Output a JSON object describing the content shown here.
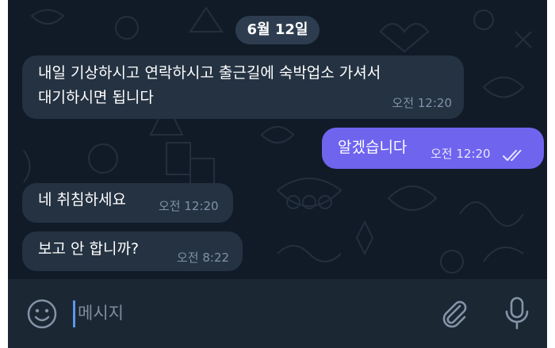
{
  "colors": {
    "background": "#111b28",
    "incoming_bubble": "#243242",
    "outgoing_bubble": "#6e64ee",
    "date_badge": "#2d3d4f",
    "input_bar": "#1c2734",
    "caret": "#5a98ea"
  },
  "chat": {
    "date_label": "6월 12일",
    "messages": [
      {
        "direction": "incoming",
        "text": "내일 기상하시고 연락하시고 출근길에 숙박업소 가셔서\n대기하시면 됩니다",
        "time": "오전 12:20"
      },
      {
        "direction": "outgoing",
        "text": "알겠습니다",
        "time": "오전 12:20",
        "status_icon": "double-check-icon"
      },
      {
        "direction": "incoming",
        "text": "네 취침하세요",
        "time": "오전 12:20"
      },
      {
        "direction": "incoming",
        "text": "보고 안 합니까?",
        "time": "오전 8:22"
      }
    ]
  },
  "composer": {
    "placeholder": "메시지",
    "left_icon": "emoji-icon",
    "right_icons": [
      "attach-icon",
      "mic-icon"
    ]
  }
}
